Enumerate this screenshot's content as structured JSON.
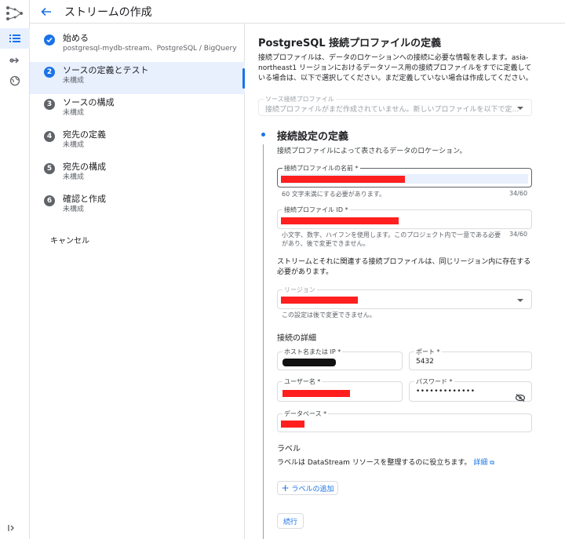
{
  "header": {
    "title": "ストリームの作成"
  },
  "rail": {
    "logo_icon": "datastream-logo-icon",
    "items": [
      "list-icon",
      "stream-icon",
      "private-connectivity-icon"
    ],
    "expand_icon": "expand-rail-icon"
  },
  "steps": [
    {
      "number": "✓",
      "name": "始める",
      "sub": "postgresql-mydb-stream、PostgreSQL / BigQuery",
      "state": "done"
    },
    {
      "number": "2",
      "name": "ソースの定義とテスト",
      "sub": "未構成",
      "state": "active"
    },
    {
      "number": "3",
      "name": "ソースの構成",
      "sub": "未構成",
      "state": "pending"
    },
    {
      "number": "4",
      "name": "宛先の定義",
      "sub": "未構成",
      "state": "pending"
    },
    {
      "number": "5",
      "name": "宛先の構成",
      "sub": "未構成",
      "state": "pending"
    },
    {
      "number": "6",
      "name": "確認と作成",
      "sub": "未構成",
      "state": "pending"
    }
  ],
  "cancel_label": "キャンセル",
  "main": {
    "title": "PostgreSQL 接続プロファイルの定義",
    "description": "接続プロファイルは、データのロケーションへの接続に必要な情報を表します。asia-northeast1 リージョンにおけるデータソース用の接続プロファイルをすでに定義している場合は、以下で選択してください。まだ定義していない場合は作成してください。",
    "source_profile": {
      "label": "ソース接続プロファイル",
      "value": "接続プロファイルがまだ作成されていません。新しいプロファイルを以下で定…"
    },
    "section_title": "接続設定の定義",
    "section_desc": "接続プロファイルによって表されるデータのロケーション。",
    "profile_name": {
      "label": "接続プロファイルの名前 *",
      "hint": "60 文字未満にする必要があります。",
      "counter": "34/60"
    },
    "profile_id": {
      "label": "接続プロファイル ID *",
      "hint": "小文字、数字、ハイフンを使用します。このプロジェクト内で一意である必要があり、後で変更できません。",
      "counter": "34/60"
    },
    "region_note": "ストリームとそれに関連する接続プロファイルは、同じリージョン内に存在する必要があります。",
    "region": {
      "label": "リージョン",
      "hint": "この設定は後で変更できません。"
    },
    "connection_details_title": "接続の詳細",
    "host": {
      "label": "ホスト名または IP *"
    },
    "port": {
      "label": "ポート *",
      "value": "5432"
    },
    "username": {
      "label": "ユーザー名 *"
    },
    "password": {
      "label": "パスワード *",
      "value": "•••••••••••••",
      "toggle_icon": "visibility-off-icon"
    },
    "database": {
      "label": "データベース *"
    },
    "labels_title": "ラベル",
    "labels_desc": "ラベルは DataStream リソースを整理するのに役立ちます。",
    "labels_link": "詳細",
    "add_label_button": "ラベルの追加",
    "continue_button": "続行"
  }
}
